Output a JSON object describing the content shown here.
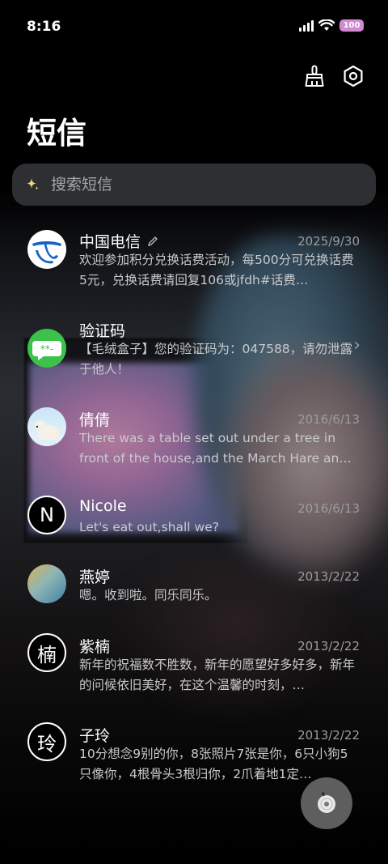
{
  "status_bar": {
    "time": "8:16",
    "battery": "100",
    "icons": [
      "signal-icon",
      "wifi-icon",
      "battery-icon"
    ]
  },
  "header": {
    "title": "短信",
    "actions": [
      "broom-icon",
      "settings-icon"
    ]
  },
  "search": {
    "placeholder": "搜索短信",
    "icon": "sparkle-icon"
  },
  "conversations": [
    {
      "name": "中国电信",
      "date": "2025/9/30",
      "preview": "欢迎参加积分兑换话费活动，每500分可兑换话费5元，兑换话费请回复106或jfdh#话费…",
      "avatar": "china-telecom-logo",
      "edit_icon": "pencil-icon"
    },
    {
      "name": "验证码",
      "date": "",
      "preview": "【毛绒盒子】您的验证码为：047588，请勿泄露于他人！",
      "avatar": "message-bubble-icon",
      "chevron": "›"
    },
    {
      "name": "倩倩",
      "date": "2016/6/13",
      "preview": "There was a table set out under a tree in front of the house,and the March Hare an…",
      "avatar": "polar-bear-photo"
    },
    {
      "name": "Nicole",
      "date": "2016/6/13",
      "preview": "Let's eat out,shall we?",
      "avatar_text": "N"
    },
    {
      "name": "燕婷",
      "date": "2013/2/22",
      "preview": "嗯。收到啦。同乐同乐。",
      "avatar": "landscape-photo"
    },
    {
      "name": "紫楠",
      "date": "2013/2/22",
      "preview": "新年的祝福数不胜数，新年的愿望好多好多，新年的问候依旧美好，在这个温馨的时刻，…",
      "avatar_text": "楠"
    },
    {
      "name": "子玲",
      "date": "2013/2/22",
      "preview": "10分想念9别的你，8张照片7张是你，6只小狗5只像你，4根骨头3根归你，2爪着地1定…",
      "avatar_text": "玲"
    }
  ],
  "fab": {
    "icon": "music-disc-icon"
  },
  "colors": {
    "background": "#000000",
    "battery": "#d18ad2",
    "telecom_blue": "#1464c8",
    "verify_green": "#3cc24a",
    "date_gray": "#9b9ca0"
  }
}
